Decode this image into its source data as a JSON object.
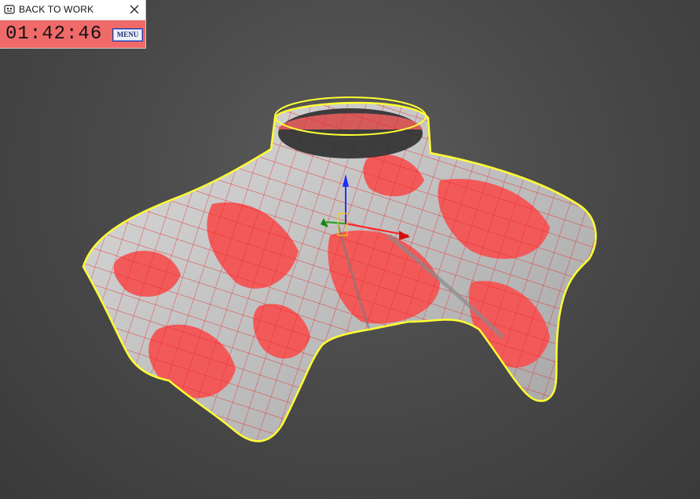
{
  "timer_widget": {
    "title": "BACK TO WORK",
    "time": "01:42:46",
    "menu_label": "MENU",
    "app_icon": "app-face-icon",
    "close_icon": "close-icon",
    "background_color": "#f06a6a"
  },
  "viewport": {
    "selection_outline_color": "#ffff33",
    "mesh_colors": [
      "#f25656",
      "#cfcfcf"
    ],
    "gizmo_axes": [
      "x-red",
      "y-green",
      "z-blue"
    ]
  }
}
